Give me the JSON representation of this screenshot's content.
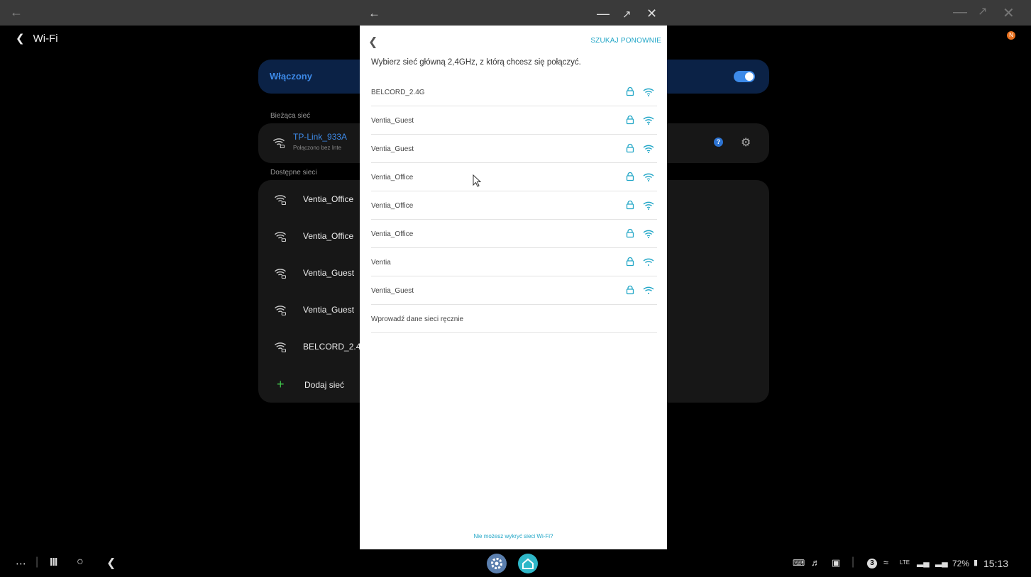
{
  "outer_window": {
    "back_icon": "arrow-left-icon"
  },
  "wifi_screen": {
    "title": "Wi-Fi",
    "toggle": {
      "label": "Włączony",
      "on": true
    },
    "current_section_label": "Bieżąca sieć",
    "current_network": {
      "name": "TP-Link_933A",
      "status": "Połączono bez Inte"
    },
    "available_section_label": "Dostępne sieci",
    "available_networks": [
      "Ventia_Office",
      "Ventia_Office",
      "Ventia_Guest",
      "Ventia_Guest",
      "BELCORD_2.4"
    ],
    "add_network_label": "Dodaj sieć"
  },
  "dialog": {
    "rescan_label": "SZUKAJ PONOWNIE",
    "title": "Wybierz sieć główną 2,4GHz, z którą chcesz się połączyć.",
    "networks": [
      "BELCORD_2.4G",
      "Ventia_Guest",
      "Ventia_Guest",
      "Ventia_Office",
      "Ventia_Office",
      "Ventia_Office",
      "Ventia",
      "Ventia_Guest"
    ],
    "manual_label": "Wprowadź dane sieci ręcznie",
    "cant_find_label": "Nie możesz wykryć sieci Wi-Fi?"
  },
  "taskbar": {
    "battery": "72%",
    "time": "15:13",
    "lte_label": "LTE",
    "notification_count": "3"
  },
  "colors": {
    "accent_blue": "#3d8ae8",
    "dialog_accent": "#21a6c7",
    "add_green": "#3fc24a"
  }
}
